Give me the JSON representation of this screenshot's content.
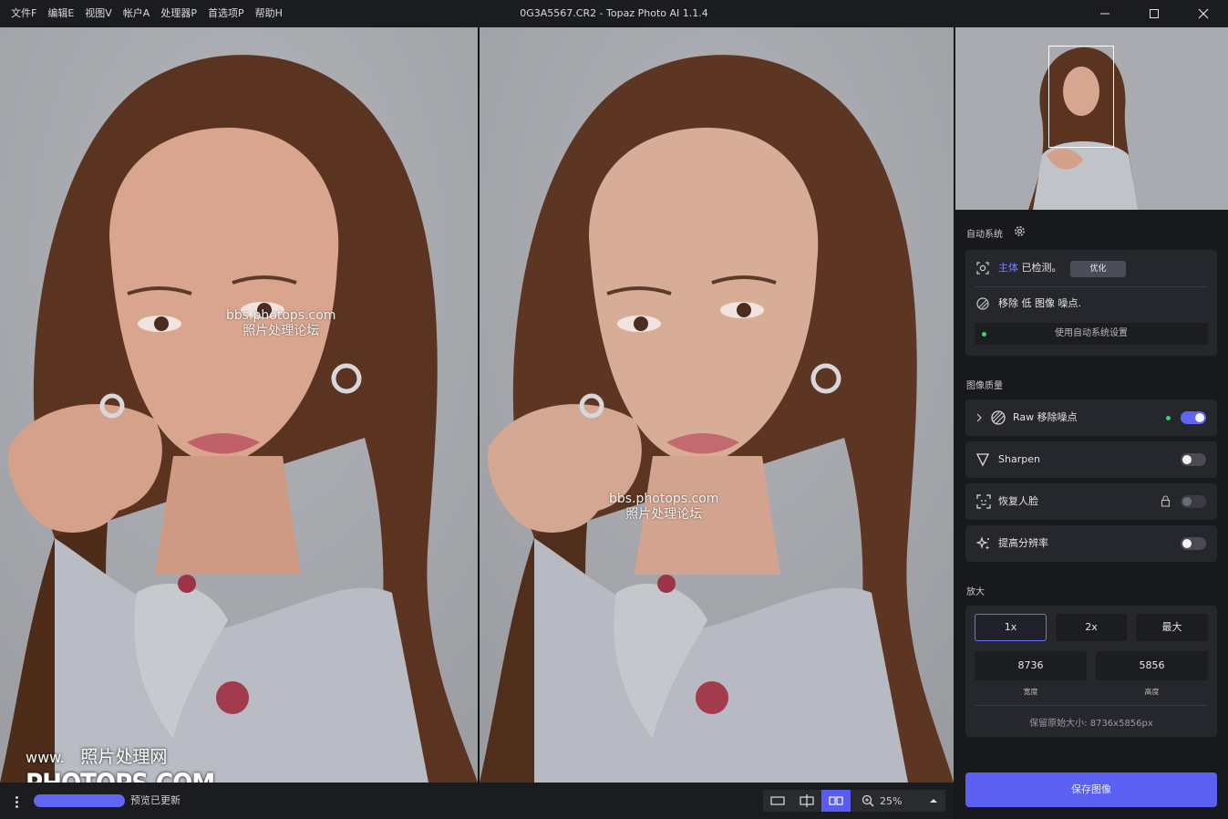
{
  "menu": [
    "文件F",
    "编辑E",
    "视图V",
    "帐户A",
    "处理器P",
    "首选项P",
    "帮助H"
  ],
  "window_title": "0G3A5567.CR2 - Topaz Photo AI 1.1.4",
  "watermarks": {
    "line1": "bbs.photops.com",
    "line2": "照片处理论坛",
    "logo_small": "www.",
    "logo_cn": "照片处理网",
    "logo_big": "PHOTOPS.COM"
  },
  "bottom": {
    "status": "预览已更新",
    "zoom": "25%",
    "view_modes": [
      "single-view-icon",
      "split-view-icon",
      "side-by-side-icon"
    ],
    "active_view": "side-by-side",
    "progress": 1.0
  },
  "autopilot": {
    "label": "自动系统",
    "subject_label": "主体",
    "subject_detected": "已检测。",
    "refine_button": "优化",
    "noise_text": "移除 低 图像 噪点.",
    "apply_button": "使用自动系统设置"
  },
  "quality": {
    "label": "图像质量",
    "items": [
      {
        "name": "Raw 移除噪点",
        "enabled": true,
        "icon": "denoise-icon",
        "expandable": true,
        "active_dot": true
      },
      {
        "name": "Sharpen",
        "enabled": false,
        "icon": "sharpen-icon"
      },
      {
        "name": "恢复人脸",
        "enabled": false,
        "icon": "face-icon",
        "locked": true
      },
      {
        "name": "提高分辨率",
        "enabled": false,
        "icon": "upscale-icon"
      }
    ]
  },
  "upscale": {
    "label": "放大",
    "options": [
      "1x",
      "2x",
      "最大"
    ],
    "selected": "1x",
    "width": "8736",
    "height": "5856",
    "width_label": "宽度",
    "height_label": "高度",
    "keep_original": "保留原始大小: 8736x5856px"
  },
  "save_button": "保存图像",
  "colors": {
    "accent": "#5b5ff2",
    "panel_bg": "#18191d",
    "card_bg": "#26272d",
    "active_dot": "#3ed26a"
  }
}
